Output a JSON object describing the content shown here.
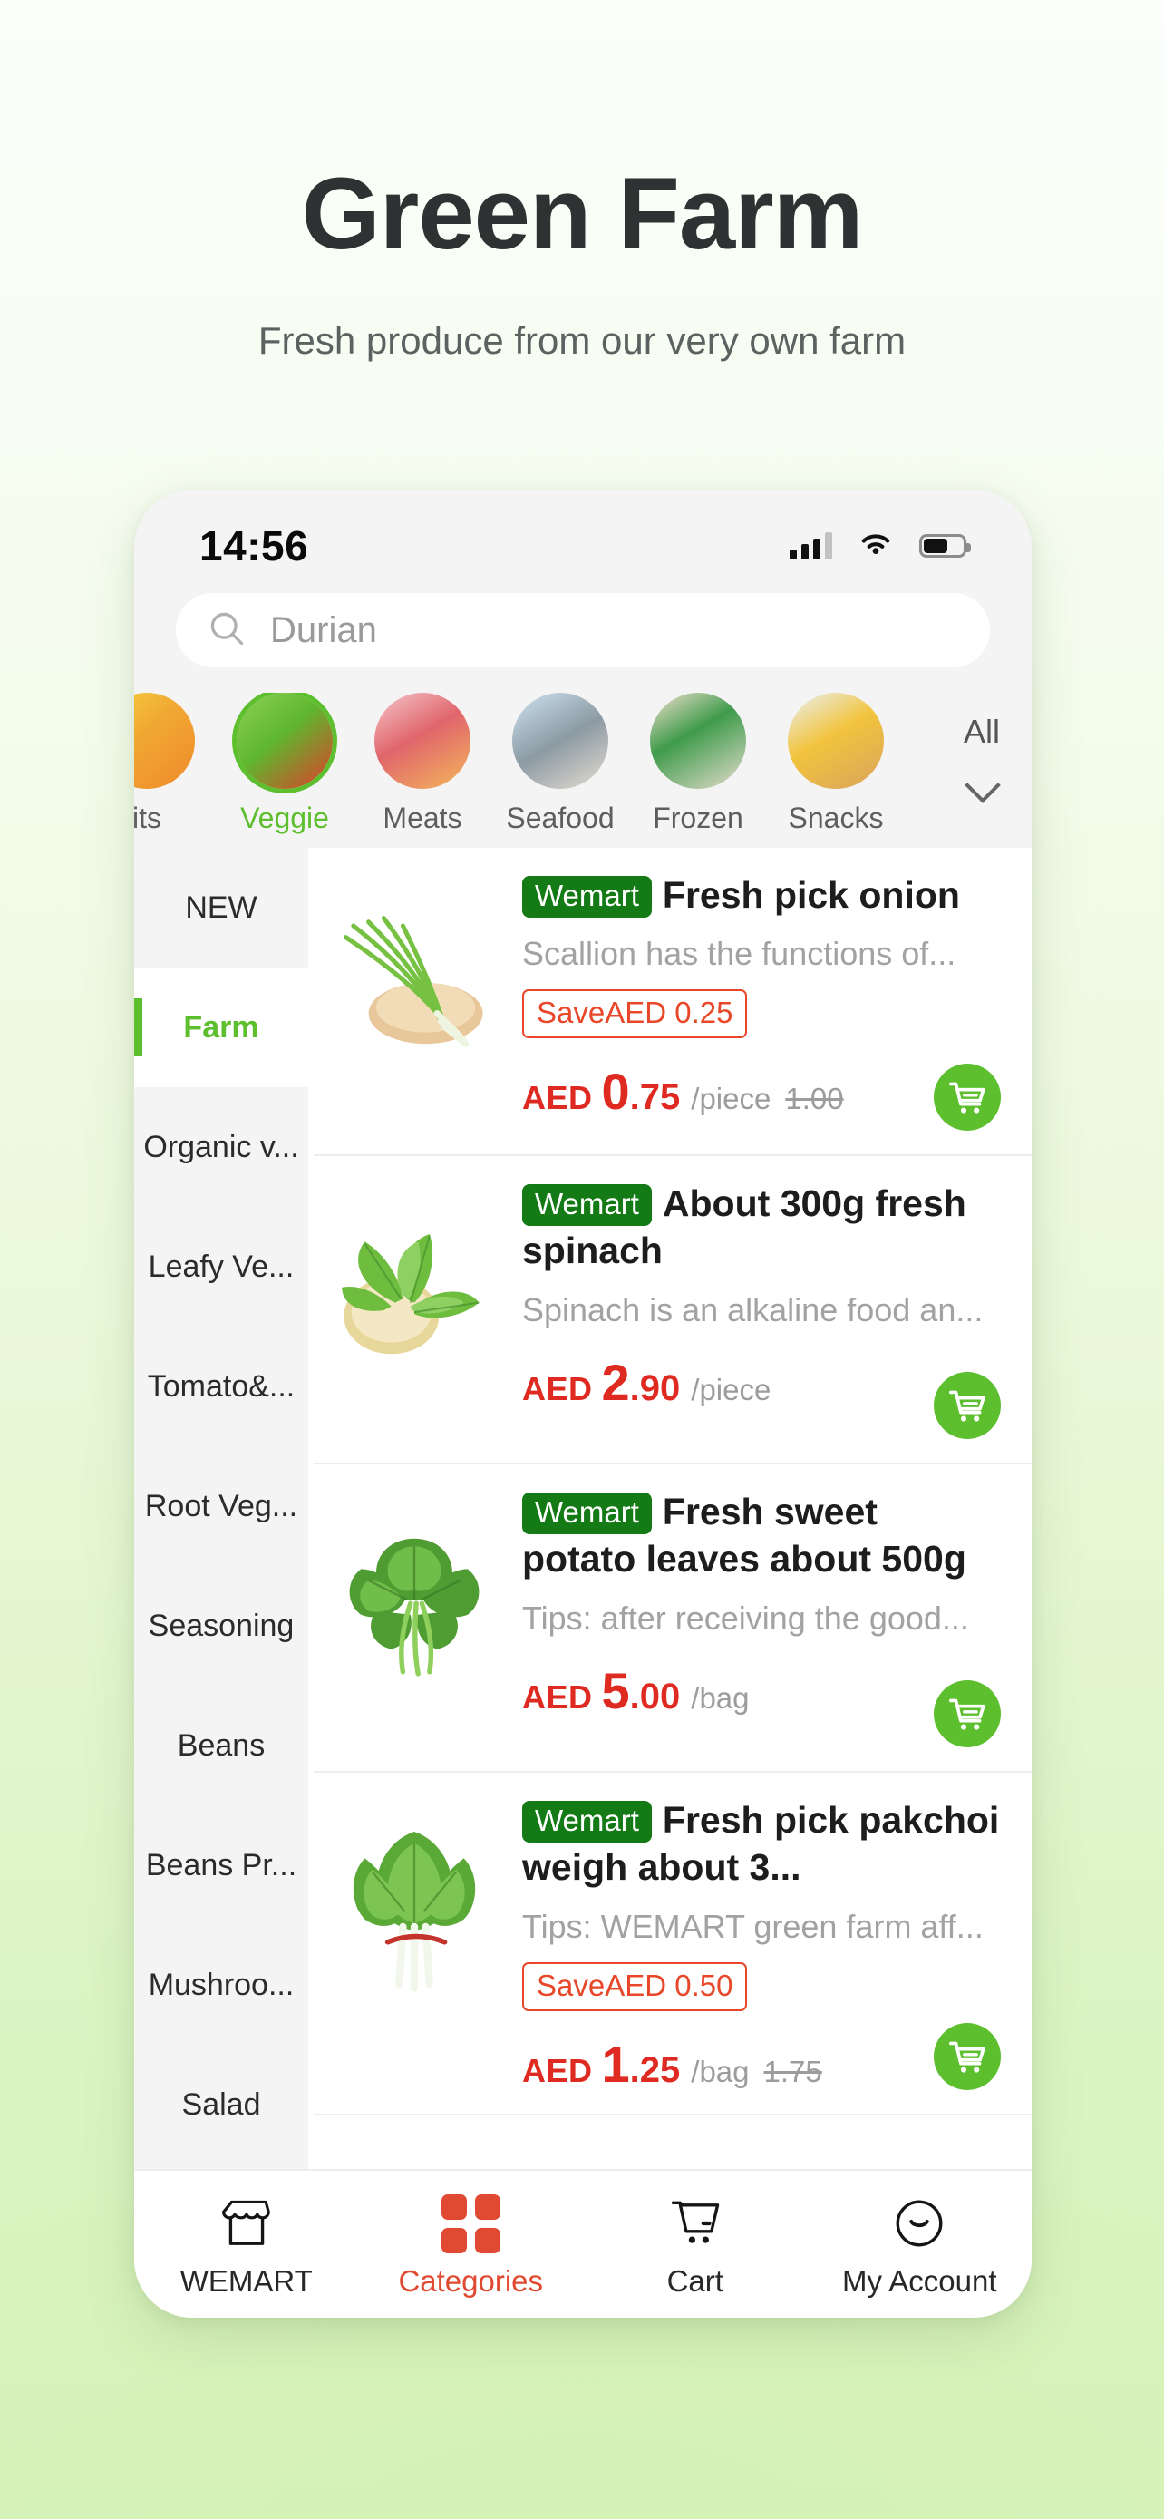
{
  "promo": {
    "title": "Green Farm",
    "subtitle": "Fresh produce from our very own farm"
  },
  "status_bar": {
    "time": "14:56",
    "signal_icon": "signal-bars-icon",
    "wifi_icon": "wifi-icon",
    "battery_icon": "battery-icon",
    "battery_level": 62
  },
  "search": {
    "icon": "search-icon",
    "placeholder": "Durian",
    "value": "Durian"
  },
  "categories": {
    "items": [
      {
        "label": "its",
        "selected": false,
        "icon": "fruits-category-icon"
      },
      {
        "label": "Veggie",
        "selected": true,
        "icon": "veggie-category-icon"
      },
      {
        "label": "Meats",
        "selected": false,
        "icon": "meats-category-icon"
      },
      {
        "label": "Seafood",
        "selected": false,
        "icon": "seafood-category-icon"
      },
      {
        "label": "Frozen",
        "selected": false,
        "icon": "frozen-category-icon"
      },
      {
        "label": "Snacks",
        "selected": false,
        "icon": "snacks-category-icon"
      }
    ],
    "all_label": "All",
    "all_icon": "chevron-down-icon"
  },
  "sidebar": {
    "items": [
      {
        "label": "NEW",
        "active": false
      },
      {
        "label": "Farm",
        "active": true
      },
      {
        "label": "Organic v...",
        "active": false
      },
      {
        "label": "Leafy Ve...",
        "active": false
      },
      {
        "label": "Tomato&...",
        "active": false
      },
      {
        "label": "Root Veg...",
        "active": false
      },
      {
        "label": "Seasoning",
        "active": false
      },
      {
        "label": "Beans",
        "active": false
      },
      {
        "label": "Beans Pr...",
        "active": false
      },
      {
        "label": "Mushroo...",
        "active": false
      },
      {
        "label": "Salad",
        "active": false
      }
    ]
  },
  "products": [
    {
      "badge": "Wemart",
      "title": "Fresh pick onion",
      "description": "Scallion has the functions of...",
      "save_label": "SaveAED 0.25",
      "currency": "AED",
      "price_int": "0",
      "price_dec": ".75",
      "unit": "/piece",
      "old_price": "1.00",
      "image": "scallion-onion-image",
      "cart_icon": "cart-icon"
    },
    {
      "badge": "Wemart",
      "title": "About 300g fresh spinach",
      "description": "Spinach is an alkaline food an...",
      "save_label": "",
      "currency": "AED",
      "price_int": "2",
      "price_dec": ".90",
      "unit": "/piece",
      "old_price": "",
      "image": "spinach-basket-image",
      "cart_icon": "cart-icon"
    },
    {
      "badge": "Wemart",
      "title": "Fresh sweet potato leaves about 500g",
      "description": "Tips: after receiving the good...",
      "save_label": "",
      "currency": "AED",
      "price_int": "5",
      "price_dec": ".00",
      "unit": "/bag",
      "old_price": "",
      "image": "sweet-potato-leaves-image",
      "cart_icon": "cart-icon"
    },
    {
      "badge": "Wemart",
      "title": "Fresh pick pakchoi weigh about 3...",
      "description": "Tips: WEMART green farm aff...",
      "save_label": "SaveAED 0.50",
      "currency": "AED",
      "price_int": "1",
      "price_dec": ".25",
      "unit": "/bag",
      "old_price": "1.75",
      "image": "pakchoi-bunch-image",
      "cart_icon": "cart-icon"
    }
  ],
  "tabbar": {
    "items": [
      {
        "label": "WEMART",
        "icon": "store-icon",
        "active": false
      },
      {
        "label": "Categories",
        "icon": "grid-icon",
        "active": true
      },
      {
        "label": "Cart",
        "icon": "shopping-cart-icon",
        "active": false
      },
      {
        "label": "My Account",
        "icon": "smiley-face-icon",
        "active": false
      }
    ]
  },
  "colors": {
    "brand_green": "#5dbf2e",
    "badge_green": "#137a16",
    "price_red": "#de2a21",
    "save_red": "#e8472a",
    "active_tab_red": "#e04a33"
  }
}
